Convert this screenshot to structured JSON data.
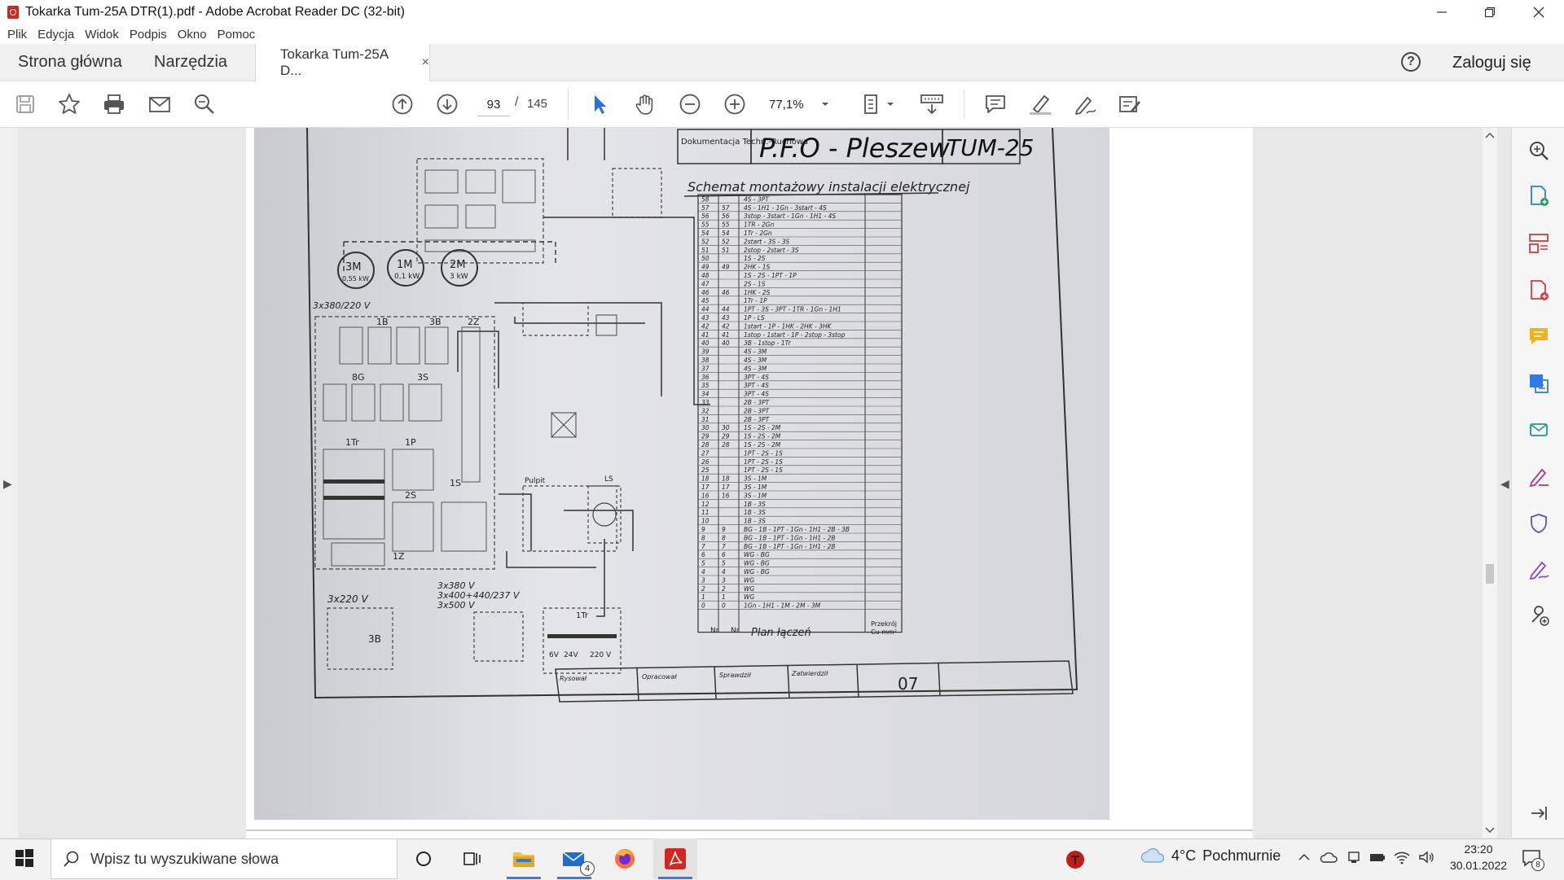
{
  "window": {
    "title": "Tokarka Tum-25A DTR(1).pdf - Adobe Acrobat Reader DC (32-bit)",
    "controls": [
      "minimize",
      "restore",
      "close"
    ]
  },
  "menu": [
    "Plik",
    "Edycja",
    "Widok",
    "Podpis",
    "Okno",
    "Pomoc"
  ],
  "tabs": {
    "home": "Strona główna",
    "tools": "Narzędzia",
    "document": "Tokarka Tum-25A D...",
    "close_symbol": "×"
  },
  "account": {
    "help_symbol": "?",
    "signin": "Zaloguj się"
  },
  "toolbar": {
    "page_current": "93",
    "page_separator": "/",
    "page_total": "145",
    "zoom": "77,1%"
  },
  "document_scan": {
    "header_left": "Dokumentacja Techn.-Ruchowa",
    "header_company": "P.F.O - Pleszew",
    "header_model": "TUM-25",
    "subtitle": "Schemat montażowy instalacji elektrycznej",
    "motors": [
      {
        "name": "3M",
        "power": "0,55 kW"
      },
      {
        "name": "1M",
        "power": "0,1 kW"
      },
      {
        "name": "2M",
        "power": "3 kW"
      }
    ],
    "supply_label": "3x380/220 V",
    "bottom_left_label": "3x220 V",
    "bottom_mid_labels": [
      "3x380 V",
      "3x400+440/237 V",
      "3x500 V"
    ],
    "block_labels": [
      "1B",
      "3B",
      "2Z",
      "8G",
      "3S",
      "1Tr",
      "1P",
      "2S",
      "1S",
      "1Z",
      "Pulpit",
      "LS",
      "3B",
      "1Tr"
    ],
    "transformer_values": [
      "6V",
      "24V",
      "220 V"
    ],
    "table_rows": [
      [
        "58",
        "",
        "4S - 3PT"
      ],
      [
        "57",
        "57",
        "4S - 1H1 - 1Gn - 3start - 4S"
      ],
      [
        "56",
        "56",
        "3stop - 3start - 1Gn - 1H1 - 4S"
      ],
      [
        "55",
        "55",
        "1TR - 2Gn"
      ],
      [
        "54",
        "54",
        "1Tr - 2Gn"
      ],
      [
        "52",
        "52",
        "2start - 3S - 3S"
      ],
      [
        "51",
        "51",
        "2stop - 2start - 3S"
      ],
      [
        "50",
        "",
        "1S - 2S"
      ],
      [
        "49",
        "49",
        "2HK - 1S"
      ],
      [
        "48",
        "",
        "1S - 2S - 1PT - 1P"
      ],
      [
        "47",
        "",
        "2S - 1S"
      ],
      [
        "46",
        "46",
        "1HK - 2S"
      ],
      [
        "45",
        "",
        "1Tr - 1P"
      ],
      [
        "44",
        "44",
        "1PT - 3S - 3PT - 1TR - 1Gn - 1H1"
      ],
      [
        "43",
        "43",
        "1P - LS"
      ],
      [
        "42",
        "42",
        "1start - 1P - 1HK - 2HK - 3HK"
      ],
      [
        "41",
        "41",
        "1stop - 1start - 1P - 2stop - 3stop"
      ],
      [
        "40",
        "40",
        "3B - 1stop - 1Tr"
      ],
      [
        "39",
        "",
        "4S - 3M"
      ],
      [
        "38",
        "",
        "4S - 3M"
      ],
      [
        "37",
        "",
        "4S - 3M"
      ],
      [
        "36",
        "",
        "3PT - 4S"
      ],
      [
        "35",
        "",
        "3PT - 4S"
      ],
      [
        "34",
        "",
        "3PT - 4S"
      ],
      [
        "33",
        "",
        "2B - 3PT"
      ],
      [
        "32",
        "",
        "2B - 3PT"
      ],
      [
        "31",
        "",
        "2B - 3PT"
      ],
      [
        "30",
        "30",
        "1S - 2S - 2M"
      ],
      [
        "29",
        "29",
        "1S - 2S - 2M"
      ],
      [
        "28",
        "28",
        "1S - 2S - 2M"
      ],
      [
        "27",
        "",
        "1PT - 2S - 1S"
      ],
      [
        "26",
        "",
        "1PT - 2S - 1S"
      ],
      [
        "25",
        "",
        "1PT - 2S - 1S"
      ],
      [
        "18",
        "18",
        "3S - 1M"
      ],
      [
        "17",
        "17",
        "3S - 1M"
      ],
      [
        "16",
        "16",
        "3S - 1M"
      ],
      [
        "12",
        "",
        "1B - 3S"
      ],
      [
        "11",
        "",
        "1B - 3S"
      ],
      [
        "10",
        "",
        "1B - 3S"
      ],
      [
        "9",
        "9",
        "BG - 1B - 1PT - 1Gn - 1H1 - 2B - 3B"
      ],
      [
        "8",
        "8",
        "BG - 1B - 1PT - 1Gn - 1H1 - 2B"
      ],
      [
        "7",
        "7",
        "BG - 1B - 1PT - 1Gn - 1H1 - 2B"
      ],
      [
        "6",
        "6",
        "WG - BG"
      ],
      [
        "5",
        "5",
        "WG - BG"
      ],
      [
        "4",
        "4",
        "WG - BG"
      ],
      [
        "3",
        "3",
        "WG"
      ],
      [
        "2",
        "2",
        "WG"
      ],
      [
        "1",
        "1",
        "WG"
      ],
      [
        "0",
        "0",
        "1Gn - 1H1 - 1M - 2M - 3M"
      ]
    ],
    "table_footer": {
      "col1": "Nr",
      "col2": "Nr",
      "plan": "Plan łączeń",
      "right_top": "Przekrój",
      "right_bottom": "Cu mm²"
    },
    "titleblock": {
      "drew_label": "Rysował",
      "checked_label": "Opracował",
      "verified_label": "Sprawdził",
      "approved_label": "Zatwierdził",
      "sheet": "07"
    }
  },
  "taskbar": {
    "search_placeholder": "Wpisz tu wyszukiwane słowa",
    "mail_badge": "4",
    "weather_temp": "4°C",
    "weather_text": "Pochmurnie",
    "time": "23:20",
    "date": "30.01.2022",
    "notif_count": "8"
  }
}
